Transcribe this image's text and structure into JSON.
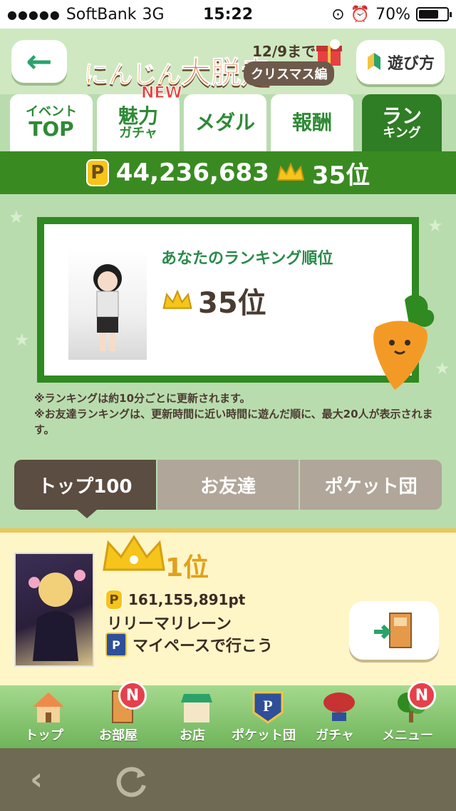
{
  "status_bar": {
    "signal": "●●●●●",
    "carrier": "SoftBank",
    "network": "3G",
    "time": "15:22",
    "battery": "70%",
    "battery_level": 0.7
  },
  "header": {
    "logo_text_1": "にんじん",
    "logo_text_2": "大脱走",
    "event_date": "12/9まで",
    "event_tag": "クリスマス編",
    "help_label": "遊び方"
  },
  "tabs": [
    {
      "small": "イベント",
      "large": "TOP"
    },
    {
      "small": "魅力",
      "large": "ガチャ"
    },
    {
      "small": "",
      "large": "メダル"
    },
    {
      "small": "",
      "large": "報酬"
    },
    {
      "small": "ラン",
      "large": "キング"
    }
  ],
  "new_badge": "NEW",
  "points": {
    "badge": "P",
    "value": "44,236,683",
    "rank": "35位"
  },
  "my_ranking": {
    "title": "あなたのランキング順位",
    "rank": "35位"
  },
  "notes": [
    "※ランキングは約10分ごとに更新されます。",
    "※お友達ランキングは、更新時間に近い時間に遊んだ順に、最大20人が表示されます。"
  ],
  "ranking_tabs": [
    "トップ100",
    "お友達",
    "ポケット団"
  ],
  "first_place": {
    "place": "1位",
    "points": "161,155,891pt",
    "name": "リリーマリレーン",
    "team_emblem": "P",
    "team": "マイペースで行こう"
  },
  "bottom_nav": [
    {
      "label": "トップ",
      "badge": ""
    },
    {
      "label": "お部屋",
      "badge": "N"
    },
    {
      "label": "お店",
      "badge": ""
    },
    {
      "label": "ポケット団",
      "badge": ""
    },
    {
      "label": "ガチャ",
      "badge": ""
    },
    {
      "label": "メニュー",
      "badge": "N"
    }
  ],
  "colors": {
    "accent_green": "#2f7d24",
    "tab_text": "#2e8a36",
    "gold": "#f6c41a"
  }
}
